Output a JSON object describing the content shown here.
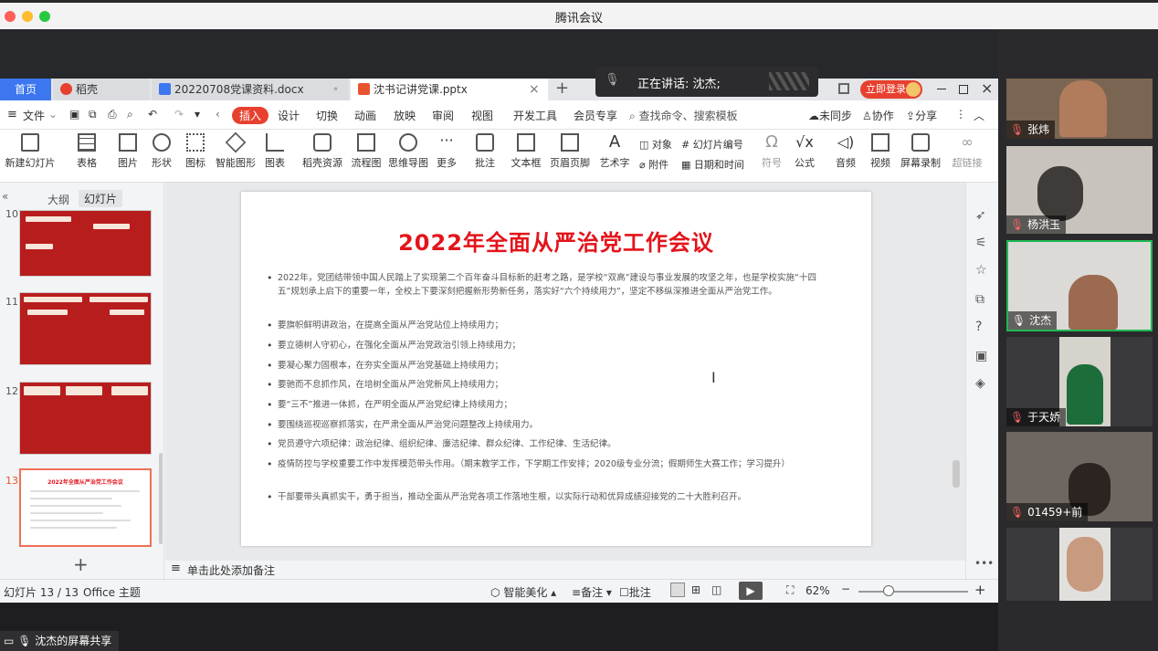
{
  "app_title": "腾讯会议",
  "speaking": "正在讲话: 沈杰;",
  "wps": {
    "tabs": {
      "home": "首页",
      "t1": "稻壳",
      "t2": "20220708党课资料.docx",
      "t3": "沈书记讲党课.pptx",
      "add": "+"
    },
    "login": "立即登录",
    "menu": {
      "file": "文件",
      "insert": "插入",
      "design": "设计",
      "switch": "切换",
      "animation": "动画",
      "show": "放映",
      "review": "审阅",
      "view": "视图",
      "dev": "开发工具",
      "member": "会员专享",
      "search": "查找命令、搜索模板",
      "unsync": "未同步",
      "collab": "协作",
      "share": "分享"
    },
    "ribbon": {
      "new_slide": "新建幻灯片",
      "table": "表格",
      "picture": "图片",
      "shape": "形状",
      "icon": "图标",
      "smart": "智能图形",
      "chart": "图表",
      "resource": "稻壳资源",
      "flow": "流程图",
      "mind": "思维导图",
      "more": "更多",
      "comment": "批注",
      "textbox": "文本框",
      "header": "页眉页脚",
      "art": "艺术字",
      "object": "对象",
      "attach": "附件",
      "slide_no": "幻灯片编号",
      "datetime": "日期和时间",
      "symbol": "符号",
      "formula": "公式",
      "audio": "音频",
      "video": "视频",
      "screen_rec": "屏幕录制",
      "hyperlink": "超链接"
    },
    "panel_tabs": {
      "outline": "大纲",
      "slides": "幻灯片"
    },
    "thumbs": [
      "10",
      "11",
      "12",
      "13"
    ],
    "thumb13_title": "2022年全面从严治党工作会议",
    "slide": {
      "title": "2022年全面从严治党工作会议",
      "bullets": [
        "2022年，党团结带领中国人民踏上了实现第二个百年奋斗目标新的赶考之路，是学校“双高”建设与事业发展的攻坚之年，也是学校实施“十四五”规划承上启下的重要一年，全校上下要深刻把握新形势新任务，落实好“六个持续用力”，坚定不移纵深推进全面从严治党工作。",
        "要旗帜鲜明讲政治，在提高全面从严治党站位上持续用力；",
        "要立德树人守初心，在强化全面从严治党政治引领上持续用力；",
        "要凝心聚力固根本，在夯实全面从严治党基础上持续用力；",
        "要驰而不息抓作风，在培树全面从严治党新风上持续用力；",
        "要“三不”推进一体抓，在严明全面从严治党纪律上持续用力；",
        "要围绕巡视巡察抓落实，在严肃全面从严治党问题整改上持续用力。",
        "党员遵守六项纪律：政治纪律、组织纪律、廉洁纪律、群众纪律、工作纪律、生活纪律。",
        "疫情防控与学校重要工作中发挥模范带头作用。（期末教学工作，下学期工作安排；2020级专业分流；假期师生大赛工作；学习提升）",
        "干部要带头真抓实干，勇于担当，推动全面从严治党各项工作落地生根，以实际行动和优异成绩迎接党的二十大胜利召开。"
      ]
    },
    "notes": "单击此处添加备注",
    "status": {
      "slide_count": "幻灯片 13 / 13",
      "theme": "Office 主题",
      "beautify": "智能美化",
      "notes": "备注",
      "comment": "批注",
      "zoom": "62%"
    }
  },
  "participants": [
    {
      "name": "张炜",
      "bg": "#7a6552"
    },
    {
      "name": "杨洪玉",
      "bg": "#c8c4bd"
    },
    {
      "name": "沈杰",
      "bg": "#dcdad6"
    },
    {
      "name": "于天娇",
      "bg": "#3a3a3c"
    },
    {
      "name": "01459+前",
      "bg": "#6e6660"
    },
    {
      "name": "",
      "bg": "#3a3a3c"
    }
  ],
  "screen_share": "沈杰的屏幕共享",
  "colors": {
    "accent": "#3c77f0",
    "insert": "#e8402f",
    "title_red": "#e3141b",
    "active_speaker": "#1fb853"
  }
}
